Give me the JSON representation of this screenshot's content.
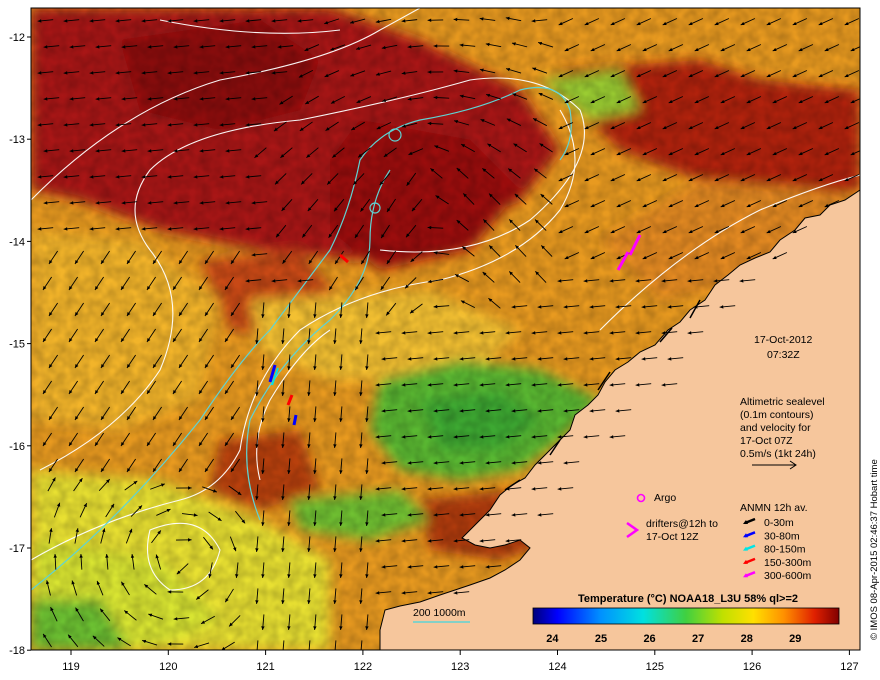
{
  "map": {
    "lon_ticks": [
      "119",
      "120",
      "121",
      "122",
      "123",
      "124",
      "125",
      "126",
      "127"
    ],
    "lat_ticks": [
      "-12",
      "-13",
      "-14",
      "-15",
      "-16",
      "-17",
      "-18"
    ]
  },
  "timestamp": {
    "date": "17-Oct-2012",
    "time": "07:32Z"
  },
  "altimetry_note": {
    "lines": [
      "Altimetric sealevel",
      "(0.1m contours)",
      "and velocity for",
      "17-Oct 07Z",
      "0.5m/s (1kt 24h)"
    ]
  },
  "legend": {
    "argo_label": "Argo",
    "drifters_line1": "drifters@12h to",
    "drifters_line2": "17-Oct 12Z",
    "anmn_title": "ANMN 12h av.",
    "anmn_items": [
      {
        "label": "0-30m",
        "color": "#000000"
      },
      {
        "label": "30-80m",
        "color": "#0000ff"
      },
      {
        "label": "80-150m",
        "color": "#00e5e5"
      },
      {
        "label": "150-300m",
        "color": "#ff0000"
      },
      {
        "label": "300-600m",
        "color": "#ff00ff"
      }
    ],
    "isobath_label": "200  1000m",
    "isobath_color": "#5fd3d3"
  },
  "colorbar": {
    "title": "Temperature (°C) NOAA18_L3U 58% ql>=2",
    "ticks": [
      "24",
      "25",
      "26",
      "27",
      "28",
      "29"
    ],
    "range": [
      23.6,
      29.9
    ]
  },
  "credit": "© IMOS 08-Apr-2015 02:46:37 Hobart time",
  "colors": {
    "land": "#f6c69c",
    "sst_hot": "#a01010",
    "sst_warm": "#e07818",
    "sst_mid": "#f0c020",
    "sst_cool": "#5ab830",
    "contour": "#ffffff",
    "argo": "#ff00ff"
  }
}
